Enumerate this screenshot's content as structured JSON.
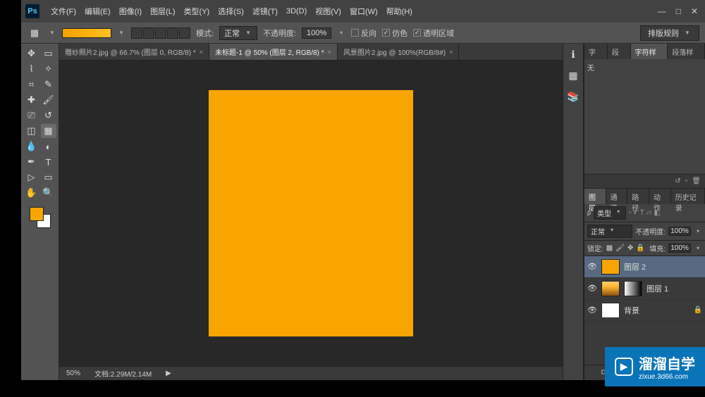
{
  "app": {
    "logo": "Ps"
  },
  "menu": {
    "file": "文件(F)",
    "edit": "编辑(E)",
    "image": "图像(I)",
    "layer": "图层(L)",
    "type": "类型(Y)",
    "select": "选择(S)",
    "filter": "滤镜(T)",
    "threeD": "3D(D)",
    "view": "视图(V)",
    "window": "窗口(W)",
    "help": "帮助(H)"
  },
  "options": {
    "mode_label": "模式:",
    "mode_value": "正常",
    "opacity_label": "不透明度:",
    "opacity_value": "100%",
    "reverse": "反向",
    "dither": "仿色",
    "transparency": "透明区域",
    "workspace": "排版规则"
  },
  "tabs": {
    "t0": "赠纱照片2.jpg @ 66.7% (图层 0, RGB/8) *",
    "t1": "未标题-1 @ 50% (图层 2, RGB/8) *",
    "t2": "风景图片2.jpg @ 100%(RGB/8#)"
  },
  "status": {
    "zoom": "50%",
    "docinfo": "文档:2.29M/2.14M"
  },
  "char_panel": {
    "tab_char": "字符",
    "tab_para": "段落",
    "tab_charstyle": "字符样式",
    "tab_parastyle": "段落样式",
    "none": "无"
  },
  "layers_panel": {
    "tab_layers": "图层",
    "tab_channels": "通道",
    "tab_paths": "路径",
    "tab_actions": "动作",
    "tab_history": "历史记录",
    "kind": "类型",
    "blend": "正常",
    "opacity_label": "不透明度:",
    "opacity": "100%",
    "lock_label": "锁定:",
    "fill_label": "填充:",
    "fill": "100%",
    "layer2": "图层 2",
    "layer1": "图层 1",
    "background": "背景"
  },
  "colors": {
    "canvas": "#f8a500",
    "fg": "#f8a500",
    "bg": "#ffffff"
  },
  "watermark": {
    "title": "溜溜自学",
    "url": "zixue.3d66.com"
  }
}
